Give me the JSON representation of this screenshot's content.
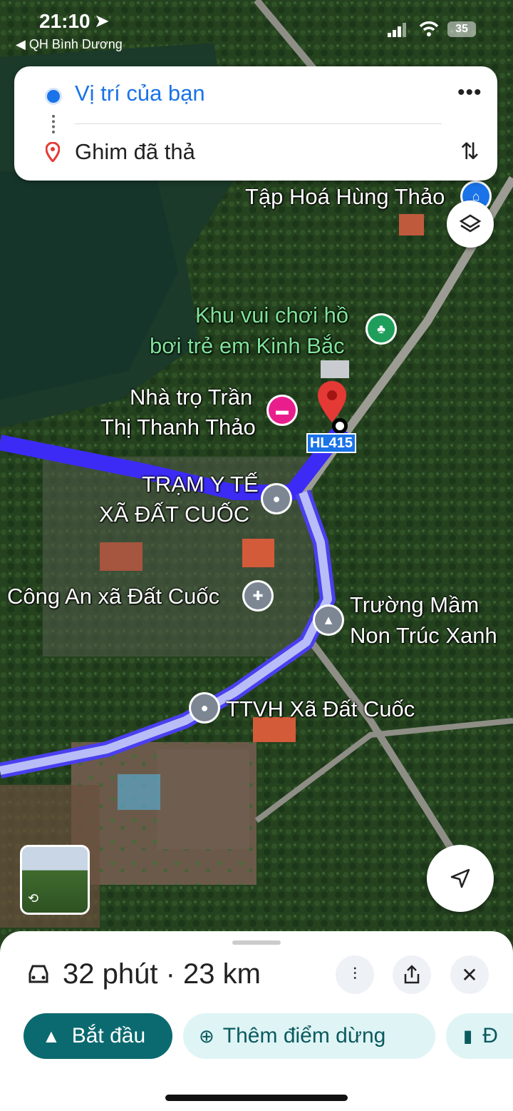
{
  "status_bar": {
    "time": "21:10",
    "back_label": "◀ QH Bình Dương",
    "battery": "35"
  },
  "directions_card": {
    "origin": "Vị trí của bạn",
    "destination": "Ghim đã thả"
  },
  "map": {
    "labels": {
      "grocery": "Tập Hoá Hùng Thảo",
      "playground_line1": "Khu vui chơi hồ",
      "playground_line2": "bơi trẻ em Kinh Bắc",
      "guesthouse_line1": "Nhà trọ Trần",
      "guesthouse_line2": "Thị Thanh Thảo",
      "health_line1": "TRẠM Y TẾ",
      "health_line2": "XÃ ĐẤT CUỐC",
      "police": "Công An xã Đất Cuốc",
      "school_line1": "Trường Mầm",
      "school_line2": "Non Trúc Xanh",
      "culture": "TTVH Xã Đất Cuốc",
      "road_shield": "HL415"
    },
    "colors": {
      "route": "#3c2bf5",
      "route_alt": "#b8bdf7",
      "pin": "#e53935",
      "green_poi": "#1e9e5a",
      "pink_poi": "#e91e8c"
    }
  },
  "sheet": {
    "duration_distance": "32 phút · 23 km",
    "buttons": {
      "start": "Bắt đầu",
      "add_stop": "Thêm điểm dừng",
      "save_partial": "Đ"
    }
  }
}
